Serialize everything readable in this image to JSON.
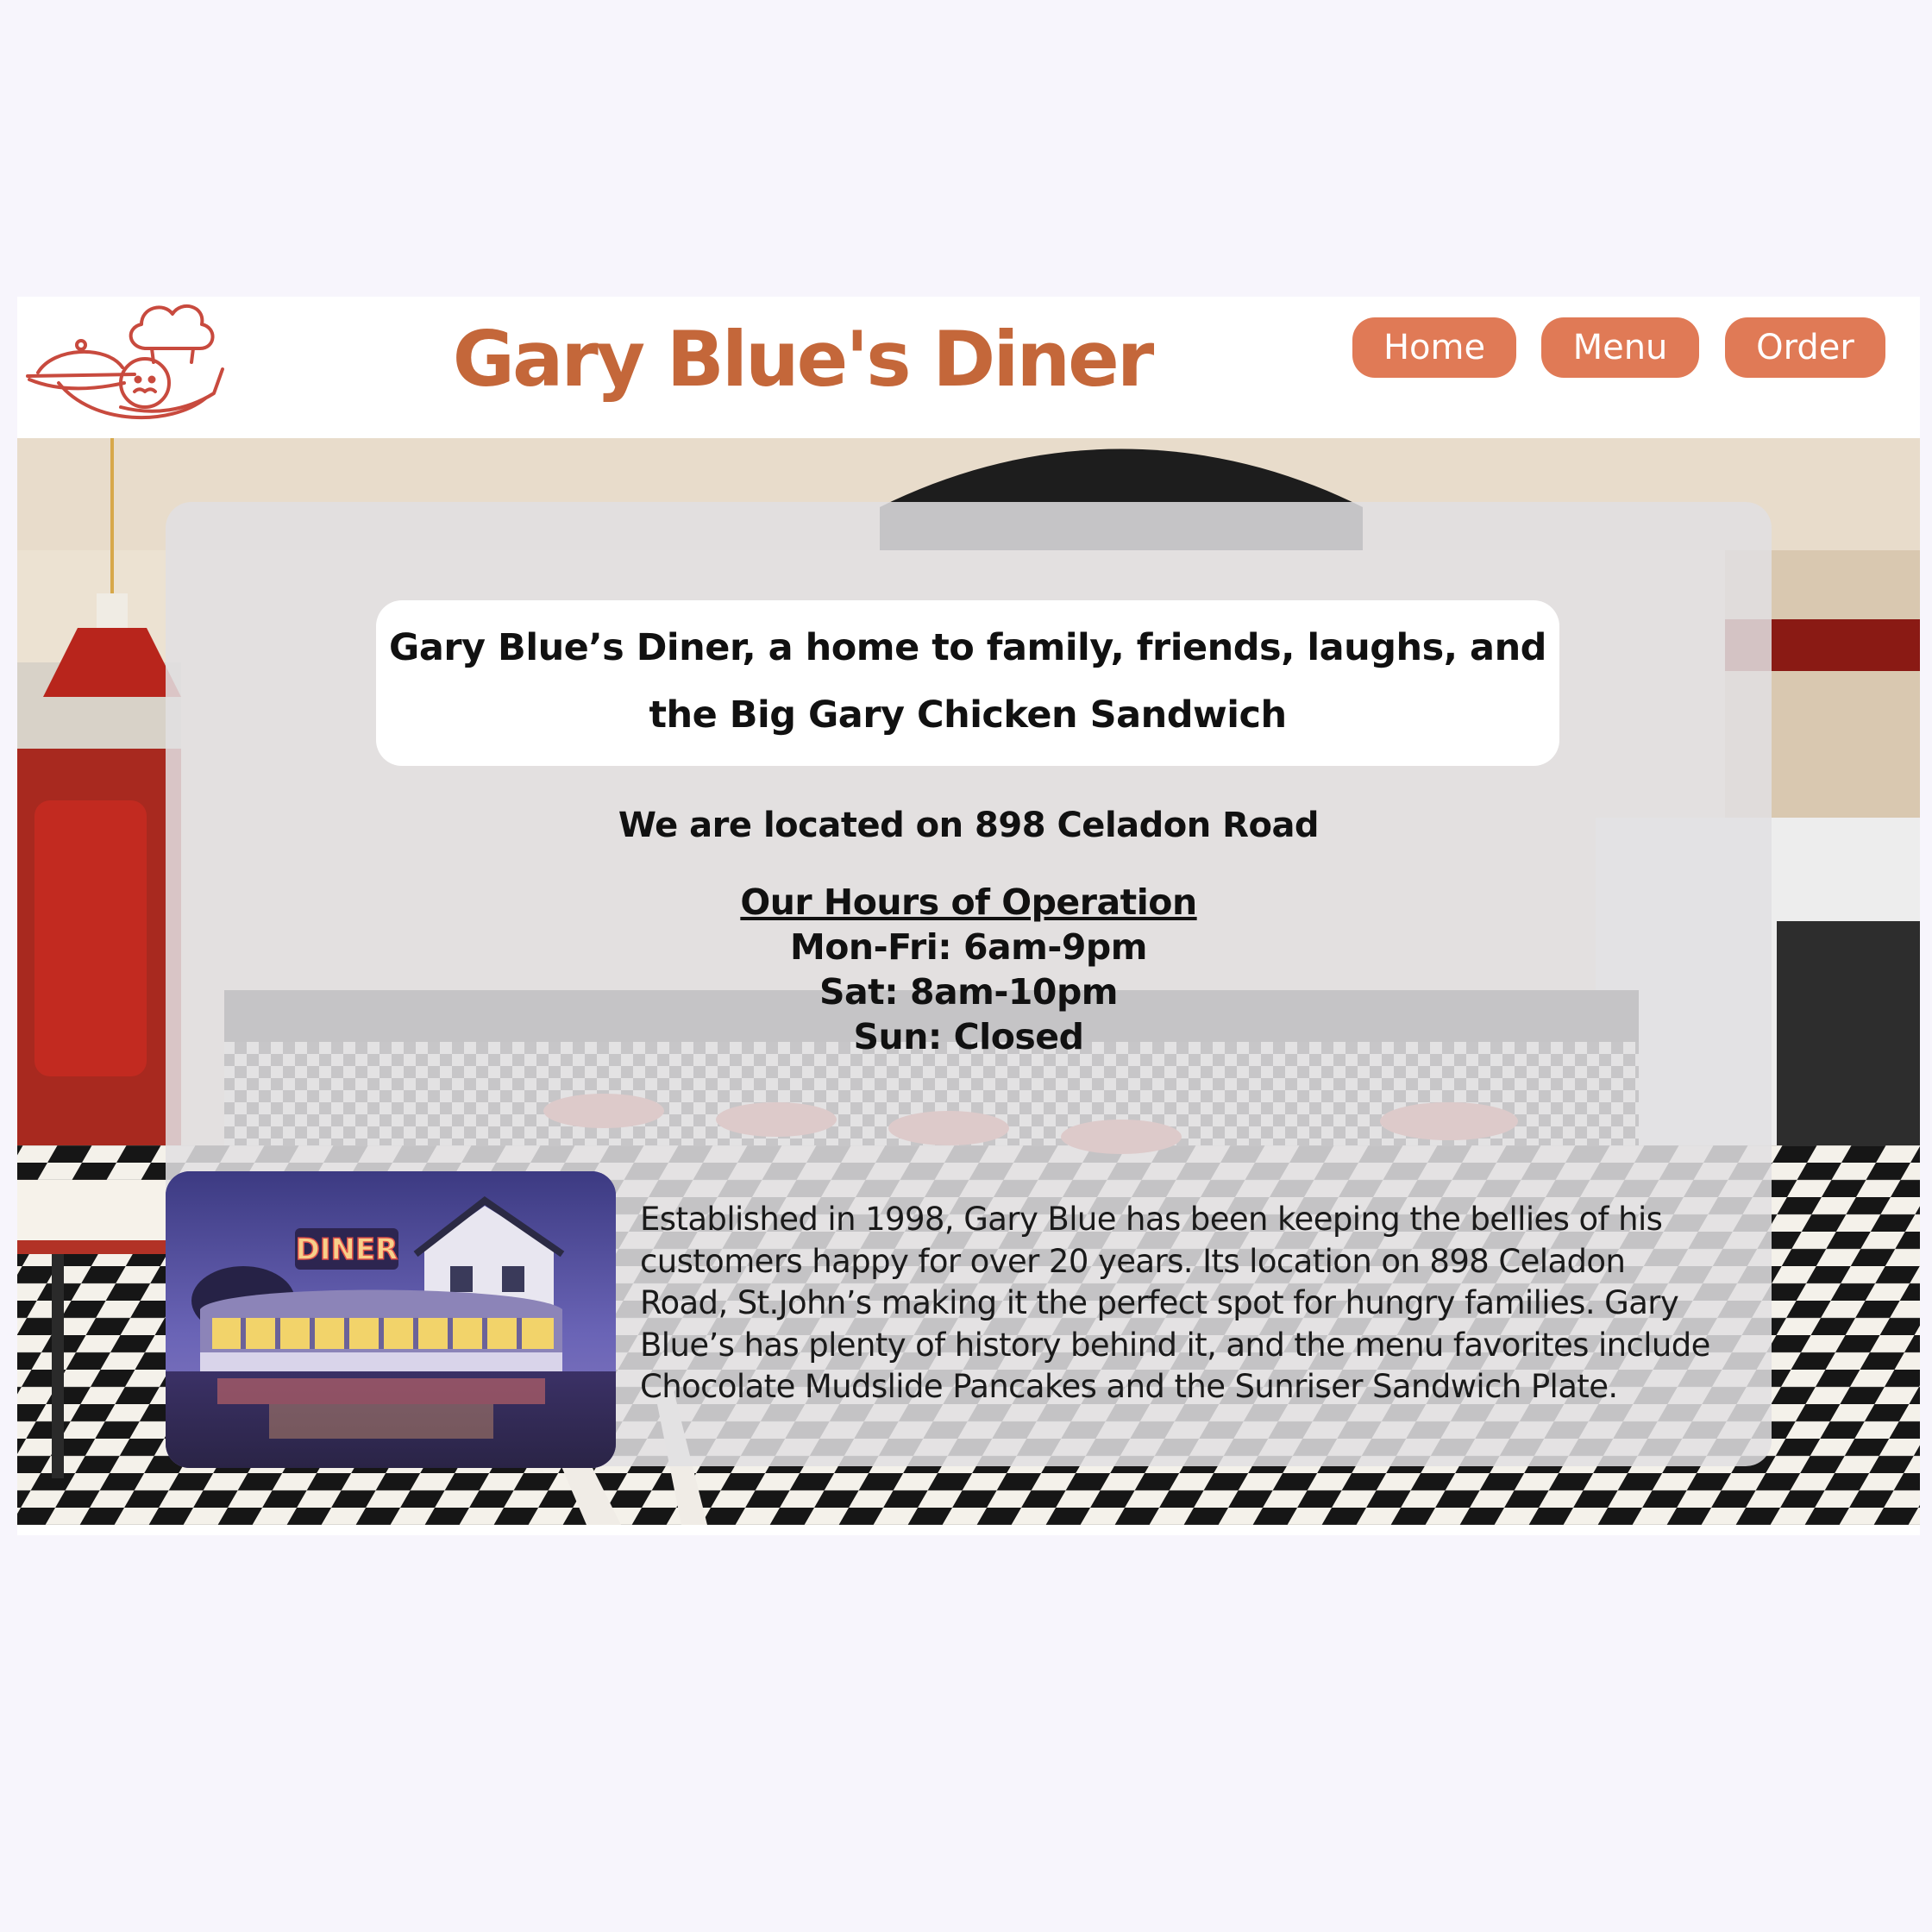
{
  "header": {
    "title": "Gary Blue's Diner",
    "logo_icon": "chef-waiter-logo-icon"
  },
  "nav": {
    "home": "Home",
    "menu": "Menu",
    "order": "Order"
  },
  "main": {
    "tagline_line1": "Gary Blue’s Diner, a home to family, friends, laughs, and",
    "tagline_line2": "the Big Gary Chicken Sandwich",
    "location": "We are located on 898 Celadon Road",
    "hours_title": "Our Hours of Operation",
    "hours": [
      "Mon-Fri: 6am-9pm",
      "Sat: 8am-10pm",
      "Sun: Closed"
    ],
    "about_lines": [
      "Established in 1998, Gary Blue has been keeping the bellies of his",
      "customers happy for over 20 years. Its location on 898 Celadon",
      "Road, St.John’s making it the perfect spot for hungry families. Gary",
      "Blue’s has plenty of history behind it, and the menu favorites include",
      "Chocolate Mudslide Pancakes and the Sunriser Sandwich Plate."
    ],
    "photo_sign": "DINER"
  },
  "colors": {
    "brand": "#c4673a",
    "button": "#e07a56",
    "page_bg": "#f7f5fc"
  }
}
